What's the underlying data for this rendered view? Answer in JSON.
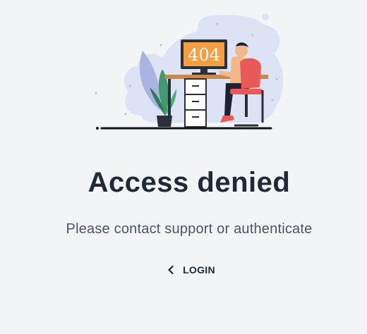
{
  "illustration": {
    "screen_text": "404"
  },
  "main": {
    "title": "Access denied",
    "subtitle": "Please contact support or authenticate",
    "login_label": "LOGIN"
  },
  "icons": {
    "back": "chevron-left-icon"
  },
  "colors": {
    "background": "#f3f4f6",
    "title": "#1f2937",
    "subtitle": "#4b5563",
    "blob": "#dde3f4",
    "screen": "#f59e42",
    "chair": "#e85a5a",
    "plant": "#3f9b6e"
  }
}
